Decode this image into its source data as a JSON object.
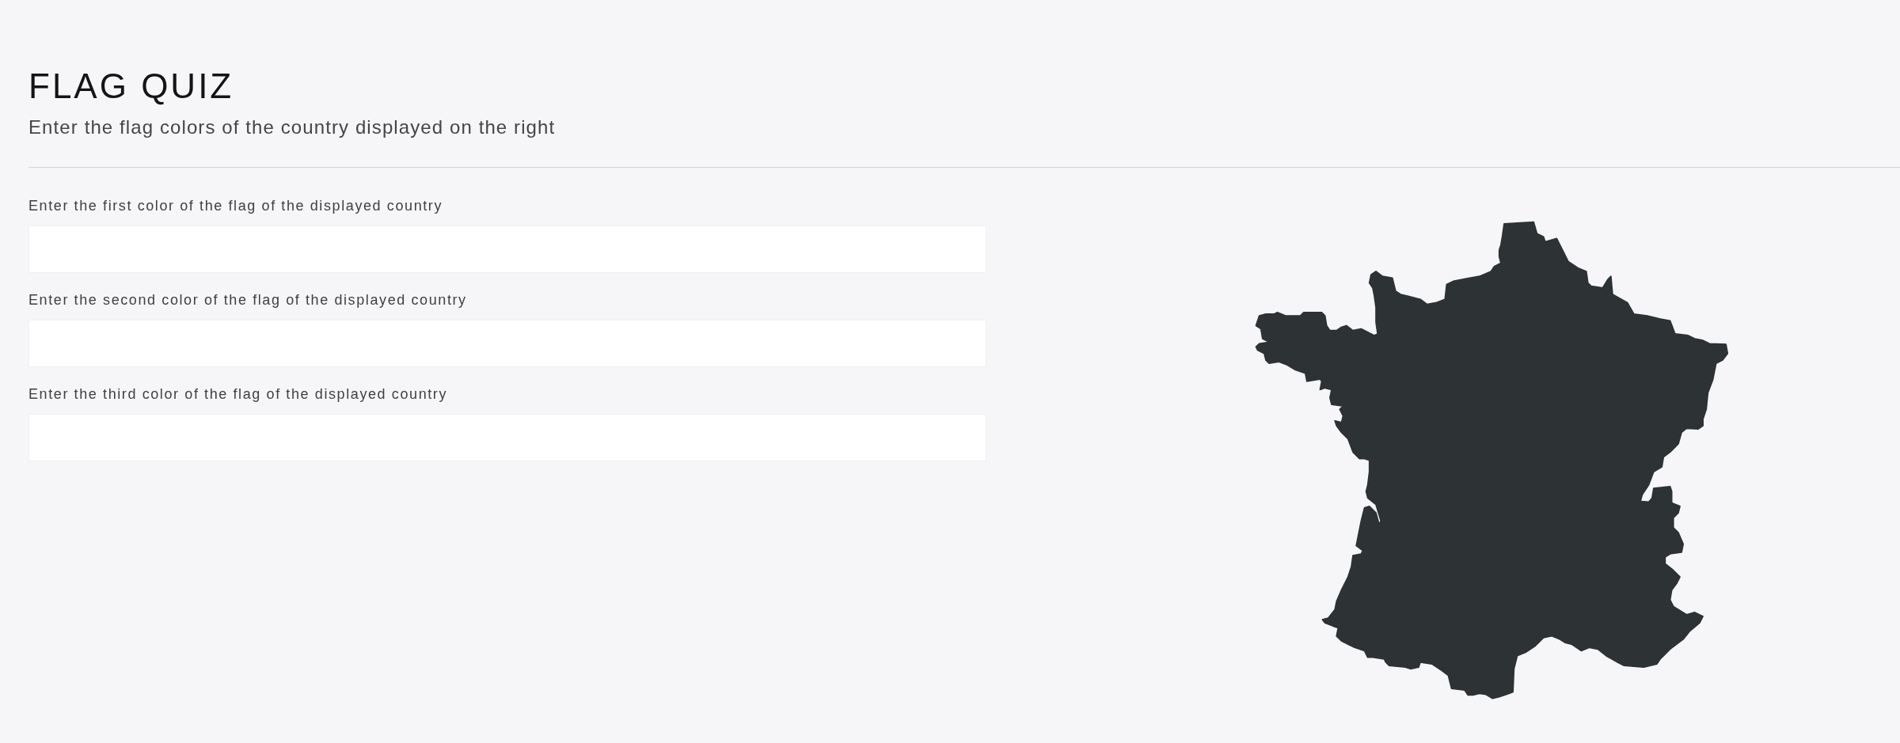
{
  "header": {
    "title": "FLAG QUIZ",
    "subtitle": "Enter the flag colors of the country displayed on the right"
  },
  "fields": [
    {
      "label": "Enter the first color of the flag of the displayed country"
    },
    {
      "label": "Enter the second color of the flag of the displayed country"
    },
    {
      "label": "Enter the third color of the flag of the displayed country"
    }
  ]
}
